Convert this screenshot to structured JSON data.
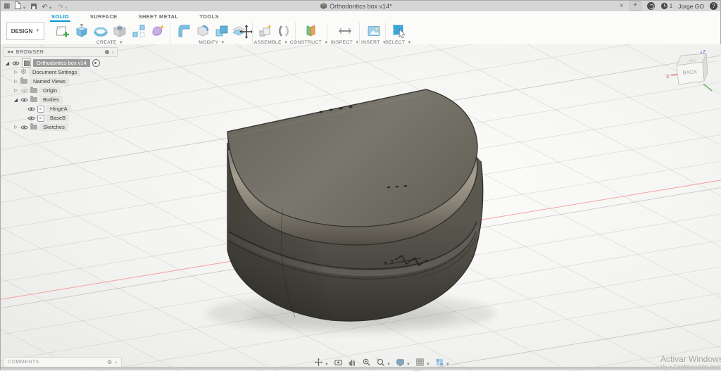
{
  "window": {
    "title": "Orthodontics box v14*",
    "close_tab_label": "×",
    "new_tab_label": "+",
    "notification_count": "1",
    "user_name": "Jorge GO",
    "help_label": "?"
  },
  "workspace": {
    "design_label": "DESIGN",
    "tabs": [
      {
        "label": "SOLID",
        "active": true
      },
      {
        "label": "SURFACE",
        "active": false
      },
      {
        "label": "SHEET METAL",
        "active": false
      },
      {
        "label": "TOOLS",
        "active": false
      }
    ]
  },
  "toolbar": {
    "groups": [
      {
        "label": "CREATE"
      },
      {
        "label": "MODIFY"
      },
      {
        "label": "ASSEMBLE"
      },
      {
        "label": "CONSTRUCT"
      },
      {
        "label": "INSPECT"
      },
      {
        "label": "INSERT"
      },
      {
        "label": "SELECT"
      }
    ]
  },
  "browser": {
    "header": "BROWSER",
    "items": [
      {
        "label": "Orthodontics box v14",
        "level": 0,
        "selected": true
      },
      {
        "label": "Document Settings",
        "level": 1
      },
      {
        "label": "Named Views",
        "level": 1
      },
      {
        "label": "Origin",
        "level": 1
      },
      {
        "label": "Bodies",
        "level": 1
      },
      {
        "label": "HingeA",
        "level": 2
      },
      {
        "label": "BaseB",
        "level": 2
      },
      {
        "label": "Sketches",
        "level": 1
      }
    ]
  },
  "viewcube": {
    "front_face": "BACK",
    "top_face": "TOP",
    "axis_x": "X",
    "axis_z": "Z"
  },
  "comments": {
    "label": "COMMENTS"
  },
  "watermark": {
    "line1": "Activar Windows",
    "line2": "Ve a Configuración para activar Windows."
  },
  "colors": {
    "accent": "#0696d7",
    "selection_bg": "#9b9b9b",
    "axis_red": "#ee9288",
    "model_top": "#75726a",
    "model_body": "#4c4a43",
    "canvas_bg": "#f3f3f1"
  }
}
